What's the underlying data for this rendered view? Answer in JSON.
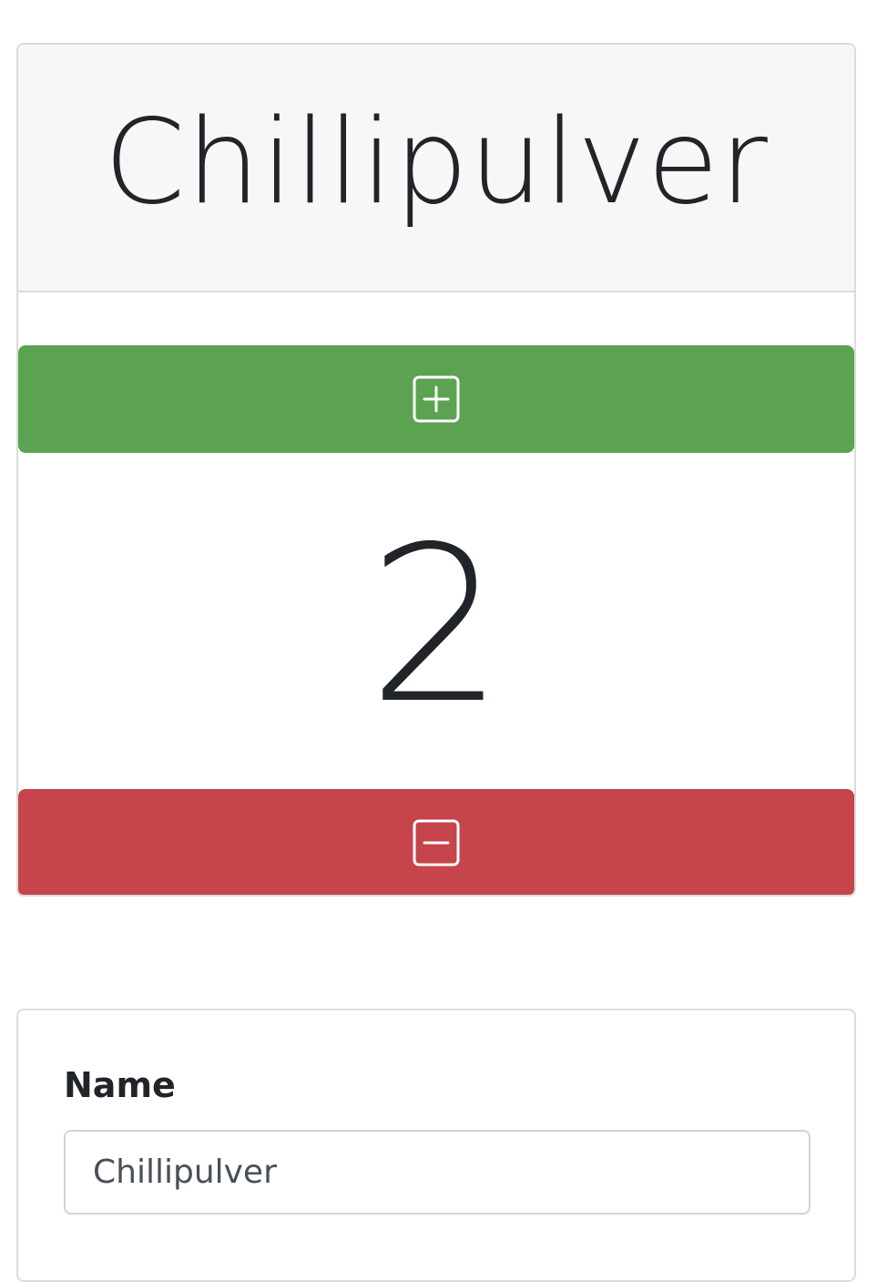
{
  "counter": {
    "title": "Chillipulver",
    "count": "2",
    "increment_icon": "plus-square-icon",
    "decrement_icon": "minus-square-icon"
  },
  "form": {
    "name_label": "Name",
    "name_value": "Chillipulver"
  },
  "colors": {
    "increment": "#5ba351",
    "decrement": "#c6444b",
    "header_bg": "#f7f7f7"
  }
}
